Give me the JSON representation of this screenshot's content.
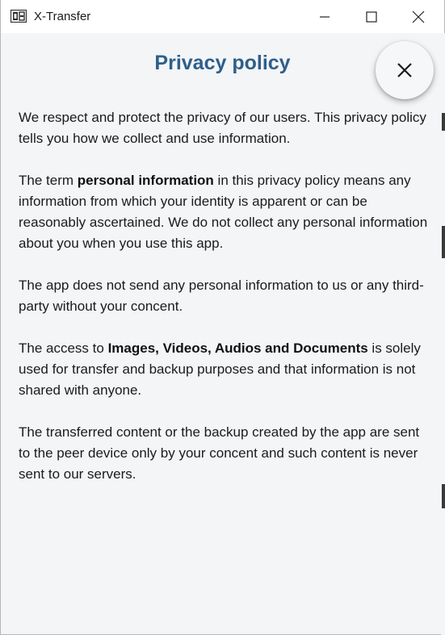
{
  "window": {
    "title": "X-Transfer",
    "controls": {
      "minimize": "minimize-icon",
      "maximize": "maximize-icon",
      "close": "close-icon"
    }
  },
  "dialog": {
    "title": "Privacy policy",
    "close_icon": "close-icon",
    "paragraphs": [
      {
        "text": "We respect and protect the privacy of our users. This privacy policy tells you how we collect and use information."
      },
      {
        "before": "The term ",
        "bold": "personal information",
        "after": " in this privacy policy means any information from which your identity is apparent or can be reasonably ascertained. We do not collect any personal information about you when you use this app."
      },
      {
        "text": "The app does not send any personal information to us or any third-party without your concent."
      },
      {
        "before": "The access to ",
        "bold": "Images, Videos, Audios and Documents",
        "after": " is solely used for transfer and backup purposes and that information is not shared with anyone."
      },
      {
        "text": "The transferred content or the backup created by the app are sent to the peer device only by your concent and such content is never sent to our servers."
      }
    ]
  },
  "colors": {
    "title": "#2e5f8a",
    "background": "#f3f5f7",
    "text": "#1b1b1b"
  }
}
